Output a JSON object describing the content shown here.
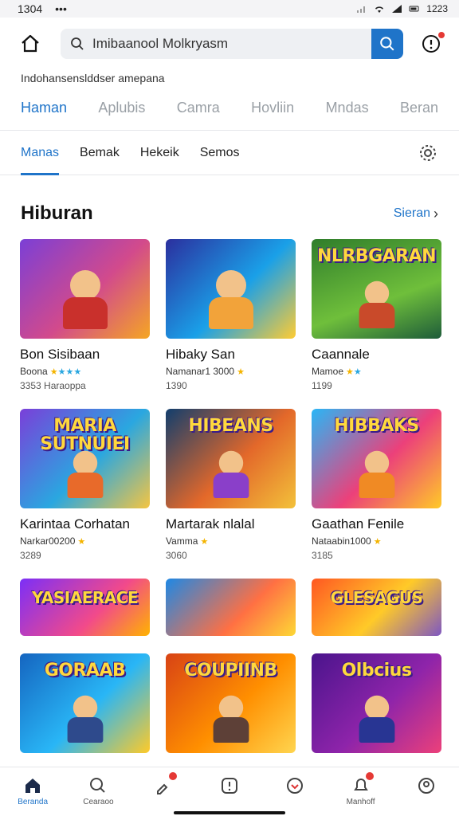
{
  "status": {
    "time": "1304",
    "dots": "•••",
    "right_time": "1223"
  },
  "search": {
    "value": "Imibaanool Molkryasm"
  },
  "subtitle": "Indohansenslddser amepana",
  "category_tabs": [
    {
      "label": "Haman",
      "active": true
    },
    {
      "label": "Aplubis",
      "active": false
    },
    {
      "label": "Camra",
      "active": false
    },
    {
      "label": "Hovliin",
      "active": false
    },
    {
      "label": "Mndas",
      "active": false
    },
    {
      "label": "Beran",
      "active": false
    }
  ],
  "sub_tabs": [
    {
      "label": "Manas",
      "active": true
    },
    {
      "label": "Bemak",
      "active": false
    },
    {
      "label": "Hekeik",
      "active": false
    },
    {
      "label": "Semos",
      "active": false
    }
  ],
  "section": {
    "title": "Hiburan",
    "see_all": "Sieran",
    "chevron": "›"
  },
  "cards": [
    {
      "name": "Bon Sisibaan",
      "meta": "Boona",
      "count": "3353 Haraoppa",
      "rating": 4,
      "thumb_title": "",
      "bg": "linear-gradient(135deg,#7b3fd6,#d24a8c 55%,#f5a623)",
      "fig": "#c9302c"
    },
    {
      "name": "Hibaky San",
      "meta": "Namanar1 3000",
      "count": "1390",
      "rating": 1,
      "thumb_title": "",
      "bg": "linear-gradient(135deg,#2b2f9e,#1aa0e8 55%,#ffcc33)",
      "fig": "#f2a33a"
    },
    {
      "name": "Caannale",
      "meta": "Mamoe",
      "count": "1199",
      "rating": 2,
      "thumb_title": "NLRBGARAN",
      "bg": "linear-gradient(160deg,#2f7d2b,#6fbf3b 60%,#1e5c3a)",
      "fig": "#c94a2a"
    },
    {
      "name": "Karintaa Corhatan",
      "meta": "Narkar00200",
      "count": "3289",
      "rating": 1,
      "thumb_title": "MARIA SUTNUIEI",
      "bg": "linear-gradient(135deg,#7a3fd9,#2aa7e0 55%,#f5c542)",
      "fig": "#e86a2a"
    },
    {
      "name": "Martarak nlalal",
      "meta": "Vamma",
      "count": "3060",
      "rating": 1,
      "thumb_title": "HIBEANS",
      "bg": "linear-gradient(135deg,#123e6d,#e3682a 55%,#f3c13a)",
      "fig": "#8a3fc9"
    },
    {
      "name": "Gaathan Fenile",
      "meta": "Nataabin1000",
      "count": "3185",
      "rating": 1,
      "thumb_title": "HIBBAKS",
      "bg": "linear-gradient(135deg,#29b6f6,#ec407a 55%,#ffca28)",
      "fig": "#f08a24"
    },
    {
      "name": "",
      "meta": "",
      "count": "",
      "rating": 0,
      "thumb_title": "YASIAERACE",
      "bg": "linear-gradient(135deg,#7b2ff7,#f24a8a 60%,#ffb300)",
      "fig": "#5a3b9c",
      "short": true
    },
    {
      "name": "",
      "meta": "",
      "count": "",
      "rating": 0,
      "thumb_title": "",
      "bg": "linear-gradient(135deg,#1e88e5,#ff7043 60%,#fdd835)",
      "fig": "#d46a2a",
      "short": true
    },
    {
      "name": "",
      "meta": "",
      "count": "",
      "rating": 0,
      "thumb_title": "GLESAGUS",
      "bg": "linear-gradient(135deg,#ff5722,#ffca28 55%,#7e57c2)",
      "fig": "#3f7bd9",
      "short": true
    },
    {
      "name": "",
      "meta": "",
      "count": "",
      "rating": 0,
      "thumb_title": "GORAAB",
      "bg": "linear-gradient(135deg,#1565c0,#29b6f6 55%,#ffca28)",
      "fig": "#2e4a8c"
    },
    {
      "name": "",
      "meta": "",
      "count": "",
      "rating": 0,
      "thumb_title": "COUPIINB",
      "bg": "linear-gradient(135deg,#d84315,#ff8f00 55%,#ffd54f)",
      "fig": "#5d4037"
    },
    {
      "name": "",
      "meta": "",
      "count": "",
      "rating": 0,
      "thumb_title": "Olbcius",
      "bg": "linear-gradient(135deg,#4a148c,#8e24aa 55%,#ec407a)",
      "fig": "#283593"
    }
  ],
  "bottom_nav": [
    {
      "label": "Beranda",
      "icon": "home-icon",
      "active": true
    },
    {
      "label": "Cearaoo",
      "icon": "search-icon",
      "active": false
    },
    {
      "label": "",
      "icon": "tag-icon",
      "active": false,
      "badge": true
    },
    {
      "label": "",
      "icon": "alert-icon",
      "active": false
    },
    {
      "label": "",
      "icon": "heart-icon",
      "active": false
    },
    {
      "label": "Manhoff",
      "icon": "bell-icon",
      "active": false,
      "badge": true
    },
    {
      "label": "",
      "icon": "profile-icon",
      "active": false
    }
  ],
  "colors": {
    "accent": "#1f74c9",
    "badge": "#e53935"
  }
}
